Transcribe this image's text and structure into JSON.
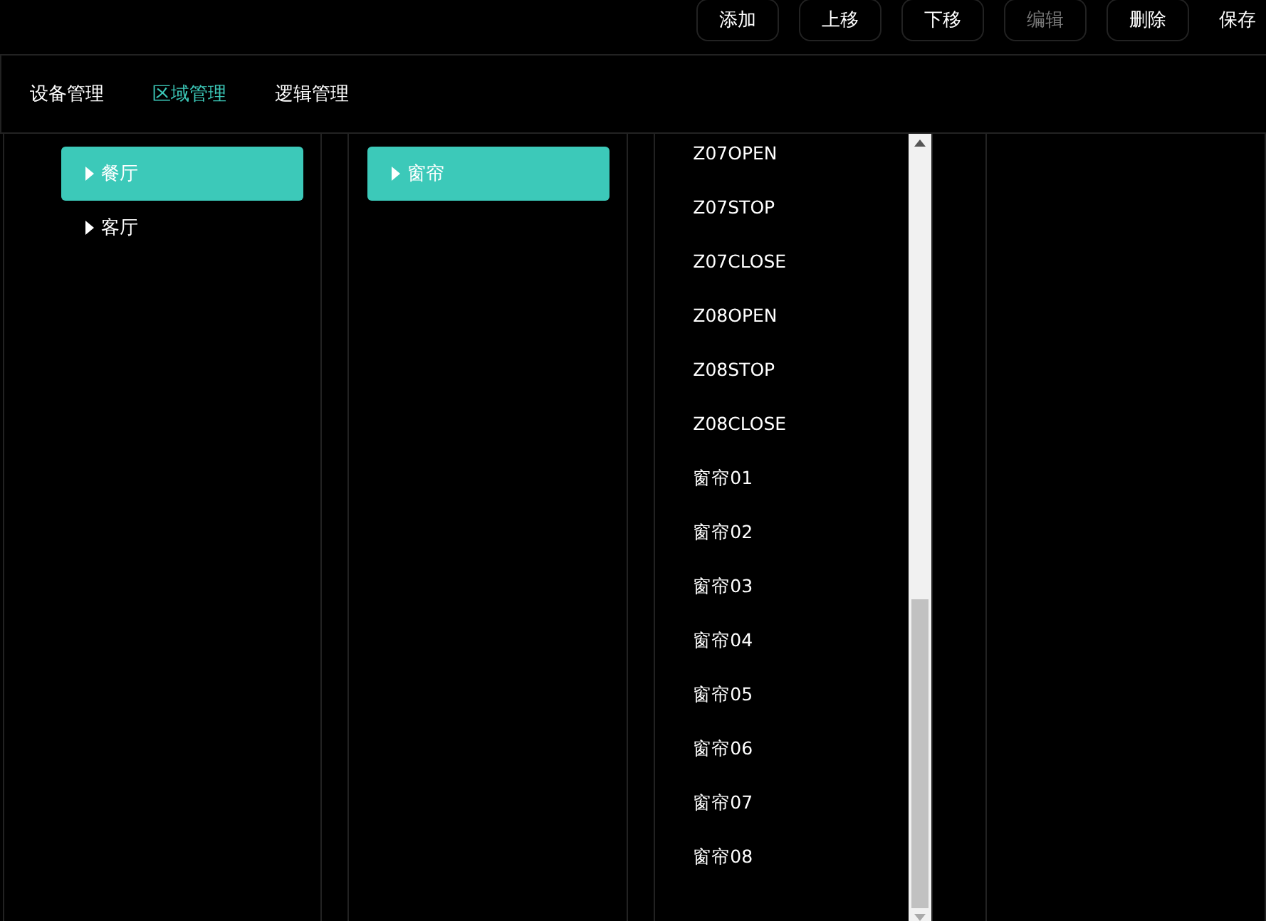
{
  "toolbar": {
    "buttons": [
      {
        "label": "添加",
        "disabled": false
      },
      {
        "label": "上移",
        "disabled": false
      },
      {
        "label": "下移",
        "disabled": false
      },
      {
        "label": "编辑",
        "disabled": true
      },
      {
        "label": "删除",
        "disabled": false
      },
      {
        "label": "保存",
        "disabled": false
      }
    ]
  },
  "tabs": [
    {
      "label": "设备管理",
      "selected": false
    },
    {
      "label": "区域管理",
      "selected": true
    },
    {
      "label": "逻辑管理",
      "selected": false
    }
  ],
  "areas": [
    {
      "label": "餐厅",
      "selected": true
    },
    {
      "label": "客厅",
      "selected": false
    }
  ],
  "devices": [
    {
      "label": "窗帘",
      "selected": true
    }
  ],
  "commands": [
    "Z07OPEN",
    "Z07STOP",
    "Z07CLOSE",
    "Z08OPEN",
    "Z08STOP",
    "Z08CLOSE",
    "窗帘01",
    "窗帘02",
    "窗帘03",
    "窗帘04",
    "窗帘05",
    "窗帘06",
    "窗帘07",
    "窗帘08"
  ]
}
